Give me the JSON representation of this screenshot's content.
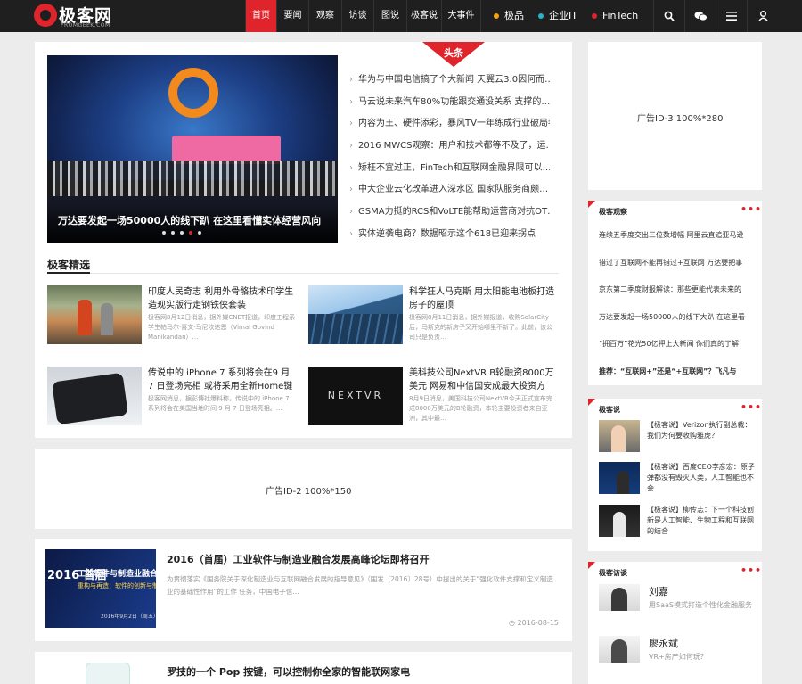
{
  "site": {
    "logo_text": "极客网",
    "logo_sub": "FROMGEEK.COM"
  },
  "nav": {
    "items": [
      {
        "label": "首页",
        "active": true
      },
      {
        "label": "要闻"
      },
      {
        "label": "观察"
      },
      {
        "label": "访谈"
      },
      {
        "label": "图说"
      },
      {
        "label": "极客说"
      },
      {
        "label": "大事件"
      }
    ],
    "channels": [
      {
        "label": "极品",
        "color": "#f2a20c"
      },
      {
        "label": "企业IT",
        "color": "#1fb7c9"
      },
      {
        "label": "FinTech",
        "color": "#e0242b"
      }
    ],
    "icons": [
      "search-icon",
      "wechat-icon",
      "menu-icon",
      "user-icon"
    ]
  },
  "headline": {
    "badge": "头条",
    "slide_caption": "万达要发起一场50000人的线下趴 在这里看懂实体经营风向",
    "slide_dots": 5,
    "slide_active": 3,
    "list": [
      "华为与中国电信搞了个大新闻 天翼云3.0因何而…",
      "马云说未来汽车80%功能跟交通没关系 支撑的…",
      "内容为王、硬件添彩，暴风TV一年练成行业破局者",
      "2016 MWCS观察：用户和技术都等不及了，运…",
      "矫枉不宜过正，FinTech和互联网金融界限可以…",
      "中大企业云化改革进入深水区 国家队服务商颇…",
      "GSMA力挺的RCS和VoLTE能帮助运营商对抗OT…",
      "实体逆袭电商？数据昭示这个618已迎来拐点"
    ]
  },
  "picks": {
    "title": "极客精选",
    "items": [
      {
        "title": "印度人民奇志 利用外骨骼技术印学生造现实版行走钢铁侠套装",
        "desc": "极客网8月12日消息，据外媒CNET报道，印度工程系学生帕马尔·喜文·马尼坎达恩（Vimal Govind Manikandan）…"
      },
      {
        "title": "科学狂人马克斯 用太阳能电池板打造房子的屋顶",
        "desc": "极客网8月11日消息，据外媒报道，收购SolarCity后，马斯克的新房子又开始哪里不新了。此前，该公司只是负责…"
      },
      {
        "title": "传说中的 iPhone 7 系列将会在9 月 7 日登场亮相 或将采用全新Home键设",
        "desc": "极客网消息，据彭博社爆料称，传说中的 iPhone 7 系列将会在美国当地时间 9 月 7 日登场亮相。…"
      },
      {
        "title": "美科技公司NextVR B轮融资8000万美元 网易和中信国安成最大投资方",
        "desc": "8月9日消息，美国科技公司NextVR今天正式宣布完成8000万美元的B轮融资，本轮主要投资者来自亚洲，其中最…"
      }
    ],
    "nextvr_logo": "NEXTVR"
  },
  "ads": {
    "ad3": "广告ID-3 100%*280",
    "ad2": "广告ID-2 100%*150"
  },
  "articles": [
    {
      "title": "2016（首届）工业软件与制造业融合发展高峰论坛即将召开",
      "desc": "为贯彻落实《国务院关于深化制造业与互联网融合发展的指导意见》（国发〔2016〕28号）中提出的关于“强化软件支撑和定义制造业的基础性作用”的工作 任务，中国电子信…",
      "date": "2016-08-15",
      "thumb": {
        "big": "2016 首届",
        "line1": "工业软件与制造业融合",
        "line2": "重构与再造：软件的创新与制造",
        "line3": "2016年9月2日（周五）"
      }
    },
    {
      "title": "罗技的一个 Pop 按键，可以控制你全家的智能联网家电"
    }
  ],
  "sidebar": {
    "watch": {
      "title": "极客观察",
      "more": "•••",
      "items": [
        {
          "text": "连续五季度交出三位数增幅 阿里云直追亚马逊"
        },
        {
          "text": "错过了互联网不能再错过+互联网 万达要把事"
        },
        {
          "text": "京东第二季度财报解读：那些更能代表未来的"
        },
        {
          "text": "万达要发起一场50000人的线下大趴 在这里看"
        },
        {
          "text": "“拥百万”花光50亿押上大新闻 你们真的了解"
        },
        {
          "text": "推荐：“互联网+”还是“+互联网”？飞凡与",
          "bold": true
        }
      ]
    },
    "talk": {
      "title": "极客说",
      "more": "•••",
      "items": [
        {
          "text": "【极客说】Verizon执行副总裁：我们为何要收购雅虎？"
        },
        {
          "text": "【极客说】百度CEO李彦宏：原子弹都没有毁灭人类，人工智能也不会"
        },
        {
          "text": "【极客说】柳传志：下一个科技创新是人工智能、生物工程和互联网的结合"
        }
      ]
    },
    "interview": {
      "title": "极客访谈",
      "more": "•••",
      "items": [
        {
          "name": "刘嘉",
          "desc": "用SaaS模式打造个性化金融服务"
        },
        {
          "name": "廖永斌",
          "desc": "VR+房产如何玩？"
        }
      ]
    }
  }
}
